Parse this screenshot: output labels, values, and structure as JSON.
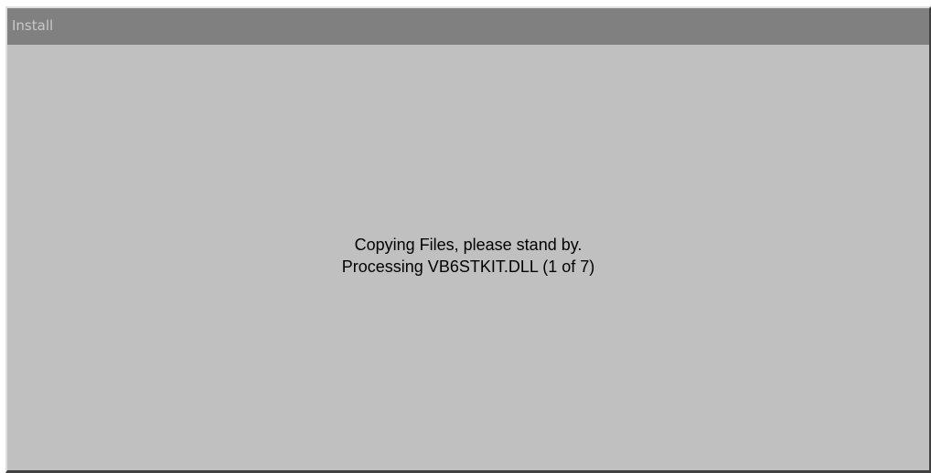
{
  "window": {
    "title": "Install"
  },
  "status": {
    "line1": "Copying Files, please stand by.",
    "line2": "Processing VB6STKIT.DLL (1 of 7)"
  },
  "colors": {
    "window_bg": "#c0c0c0",
    "titlebar_inactive": "#808080",
    "title_text": "#c8c8c8"
  }
}
